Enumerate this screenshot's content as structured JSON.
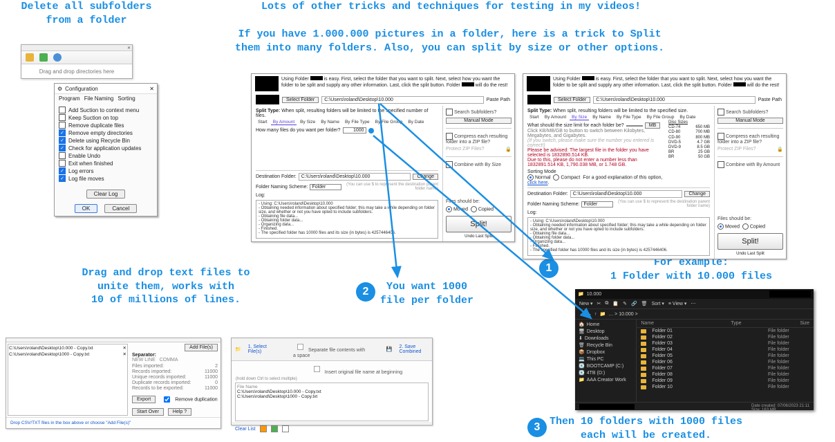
{
  "annotations": {
    "delete_subfolders": "Delete all subfolders\nfrom a folder",
    "tricks_header": "Lots of other tricks and techniques for testing in my videos!",
    "split_desc": "If you have 1.000.000 pictures in a folder, here is a trick to Split\nthem into many folders. Also, you can split by size or other options.",
    "drag_txt": "Drag and drop text files to\nunite them, works with\n10 of millions of lines.",
    "step1": "For example:\n1 Folder with 10.000 files",
    "step2": "You want 1000\nfile per folder",
    "step3": "Then 10 folders with 1000 files\neach will be created."
  },
  "dragdrop": {
    "hint": "Drag and drop directories here"
  },
  "config": {
    "title": "Configuration",
    "tabs": [
      "Program",
      "File Naming",
      "Sorting"
    ],
    "options": [
      {
        "label": "Add Suction to context menu",
        "checked": false
      },
      {
        "label": "Keep Suction on top",
        "checked": false
      },
      {
        "label": "Remove duplicate files",
        "checked": false
      },
      {
        "label": "Remove empty directories",
        "checked": true
      },
      {
        "label": "Delete using Recycle Bin",
        "checked": true
      },
      {
        "label": "Check for application updates",
        "checked": true
      },
      {
        "label": "Enable Undo",
        "checked": false
      },
      {
        "label": "Exit when finished",
        "checked": false
      },
      {
        "label": "Log errors",
        "checked": true
      },
      {
        "label": "Log file moves",
        "checked": true
      }
    ],
    "clear_log": "Clear Log",
    "ok": "OK",
    "cancel": "Cancel"
  },
  "split_common": {
    "intro": "is easy. First, select the folder that you want to split. Next, select how you want the folder to be split and supply any other information. Last, click the split button. Folder",
    "intro_tail": "will do the rest!",
    "select_folder_btn": "Select Folder",
    "paste_path": "Paste Path",
    "path": "C:\\Users\\roland\\Desktop\\10.000",
    "split_type_label": "Split Type:",
    "tabs": [
      "Start",
      "By Amount",
      "By Size",
      "By Name",
      "By File Type",
      "By File Group",
      "By Date"
    ],
    "search_sub": "Search Subfolders?",
    "manual_mode": "Manual Mode",
    "compress": "Compress each resulting folder into a ZIP file?",
    "protect_zip": "Protect ZIP Files?",
    "dest_label": "Destination Folder:",
    "dest_path": "C:\\Users\\roland\\Desktop\\10.000",
    "change": "Change",
    "naming_label": "Folder Naming Scheme:",
    "naming_value": "Folder",
    "naming_hint": "(You can use $ to represent the destination parent folder name)",
    "files_should": "Files should be:",
    "moved": "Moved",
    "copied": "Copied",
    "split_btn": "Split!",
    "undo": "Undo Last Split",
    "log_label": "Log:",
    "log_lines": [
      "- Using: C:\\Users\\roland\\Desktop\\10.000",
      "- Obtaining needed information about specified folder; this may take a while depending on folder size, and whether or not you have opted to include subfolders.",
      "- Obtaining file data...",
      "- Obtaining folder data...",
      "- Organizing data...",
      "- Finished.",
      "- The specified folder has 10000 files and its size (in bytes) is 4257446406."
    ]
  },
  "split1": {
    "desc": "When split, resulting folders will be limited to the specified number of files.",
    "question": "How many files do you want per folder?",
    "value": "1000",
    "combine": "Combine with By Size",
    "active_tab": "By Amount"
  },
  "split2": {
    "desc": "When split, resulting folders will be limited to the specified size.",
    "question": "What should the size limit for each folder be?",
    "hint1": "Click KB/MB/GB to button to switch between Kilobytes, Megabytes, and Gigabytes.",
    "hint2": "(If you switch, please make sure the number you entered is correct!)",
    "warn1": "Please be advised: The largest file in the folder you have selected is 1832890.514 KB.",
    "warn2": "Due to this, please do not enter a number less than 1832891.514 KB, 1,790.038 MB, or 1.748 GB.",
    "sorting": "Sorting Mode",
    "normal": "Normal",
    "compact": "Compact",
    "sort_link": "For a good explanation of this option, click here.",
    "mb": "MB",
    "combine": "Combine with By Amount",
    "active_tab": "By Size",
    "discs": {
      "header": "Disc Sizes",
      "rows": [
        [
          "CD-74",
          "650 MB"
        ],
        [
          "CD-80",
          "700 MB"
        ],
        [
          "CD-90",
          "800 MB"
        ],
        [
          "DVD-5",
          "4.7 GB"
        ],
        [
          "DVD-9",
          "8.5 GB"
        ],
        [
          "BR",
          "25 GB"
        ],
        [
          "BR",
          "50 GB"
        ]
      ]
    }
  },
  "csv1": {
    "files": [
      "C:\\Users\\roland\\Desktop\\10.000 - Copy.txt",
      "C:\\Users\\roland\\Desktop\\1000 - Copy.txt"
    ],
    "add_files": "Add File(s)",
    "separator": "Separator:",
    "sep_new": "NEW LINE",
    "sep_comma": "COMMA",
    "rows": [
      [
        "Files imported:",
        "2"
      ],
      [
        "Records imported:",
        "11000"
      ],
      [
        "Unique records imported:",
        "11000"
      ],
      [
        "Duplicate records imported:",
        "0"
      ],
      [
        "Records to be exported:",
        "11000"
      ]
    ],
    "export": "Export",
    "remove_dup": "Remove duplication",
    "start_over": "Start Over",
    "help": "Help ?",
    "footer": "Drop CSV/TXT files in the box above or choose \"Add File(s)\""
  },
  "csv2": {
    "step1": "1. Select File(s)",
    "step2": "2. Save Combined",
    "opt1": "Separate file contents with a space",
    "opt2": "Insert original file name at beginning",
    "list_header": "File Name",
    "files": [
      "C:\\Users\\roland\\Desktop\\10.000 - Copy.txt",
      "C:\\Users\\roland\\Desktop\\1000 - Copy.txt"
    ],
    "clear": "Clear List"
  },
  "explorer": {
    "title": "10.000",
    "new": "New",
    "sort": "Sort",
    "view": "View",
    "address": [
      "10.000"
    ],
    "nav": [
      "Home",
      "Desktop",
      "Downloads",
      "Recycle Bin",
      "Dropbox",
      "This PC",
      "BOOTCAMP (C:)",
      "4TB (D:)",
      "AAA Creator Work"
    ],
    "cols": [
      "Name",
      "Type",
      "Size"
    ],
    "rows": [
      [
        "Folder 01",
        "File folder"
      ],
      [
        "Folder 02",
        "File folder"
      ],
      [
        "Folder 03",
        "File folder"
      ],
      [
        "Folder 04",
        "File folder"
      ],
      [
        "Folder 05",
        "File folder"
      ],
      [
        "Folder 06",
        "File folder"
      ],
      [
        "Folder 07",
        "File folder"
      ],
      [
        "Folder 08",
        "File folder"
      ],
      [
        "Folder 09",
        "File folder"
      ],
      [
        "Folder 10",
        "File folder"
      ]
    ],
    "status": "Date created: 07/06/2023 21:11\nSize: 163 MB"
  }
}
